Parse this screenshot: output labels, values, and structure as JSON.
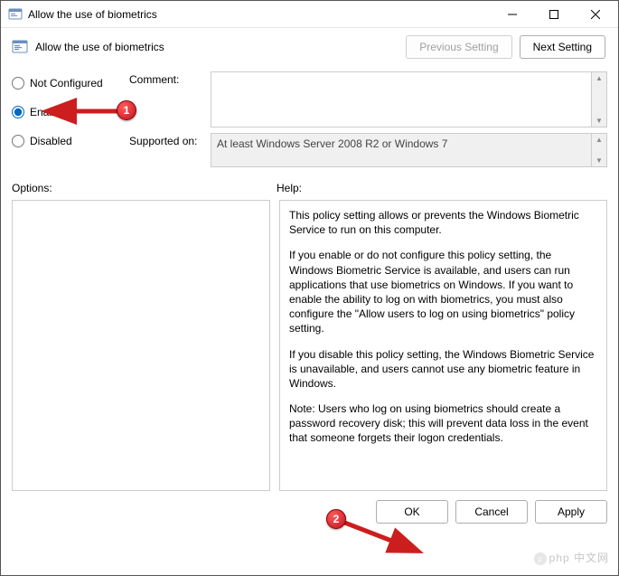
{
  "window": {
    "title": "Allow the use of biometrics"
  },
  "header": {
    "policy_name": "Allow the use of biometrics",
    "prev_setting": "Previous Setting",
    "next_setting": "Next Setting"
  },
  "radios": {
    "not_configured": "Not Configured",
    "enabled": "Enabled",
    "disabled": "Disabled",
    "selected": "enabled"
  },
  "fields": {
    "comment_label": "Comment:",
    "comment_value": "",
    "supported_label": "Supported on:",
    "supported_value": "At least Windows Server 2008 R2 or Windows 7"
  },
  "labels": {
    "options": "Options:",
    "help": "Help:"
  },
  "help_paragraphs": [
    "This policy setting allows or prevents the Windows Biometric Service to run on this computer.",
    "If you enable or do not configure this policy setting, the Windows Biometric Service is available, and users can run applications that use biometrics on Windows. If you want to enable the ability to log on with biometrics, you must also configure the \"Allow users to log on using biometrics\" policy setting.",
    "If you disable this policy setting, the Windows Biometric Service is unavailable, and users cannot use any biometric feature in Windows.",
    "Note: Users who log on using biometrics should create a password recovery disk; this will prevent data loss in the event that someone forgets their logon credentials."
  ],
  "buttons": {
    "ok": "OK",
    "cancel": "Cancel",
    "apply": "Apply"
  },
  "annotations": {
    "badge1": "1",
    "badge2": "2"
  },
  "watermark": "php 中文网"
}
